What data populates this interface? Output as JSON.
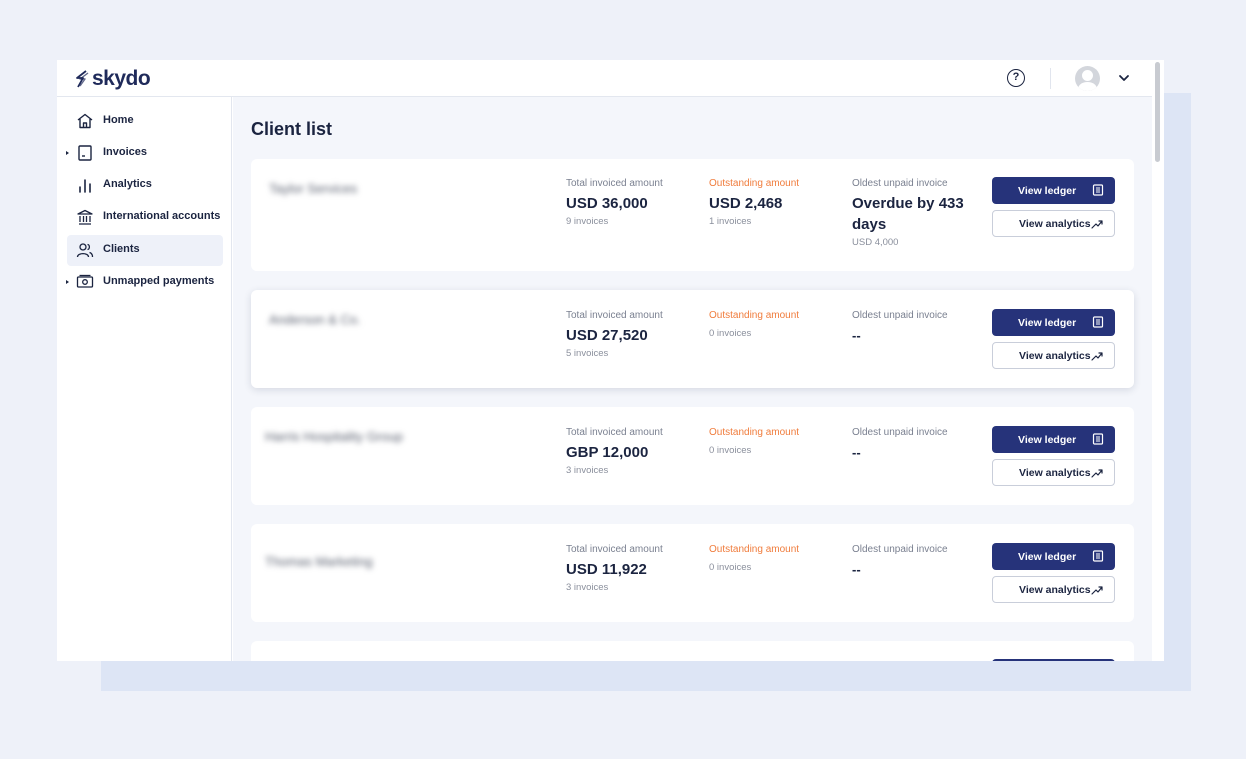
{
  "app": {
    "logo_text": "skydo"
  },
  "topbar": {
    "help_icon": "help-circle-icon",
    "avatar_icon": "user-avatar-icon",
    "menu_icon": "chevron-down-icon"
  },
  "sidebar": {
    "items": [
      {
        "label": "Home",
        "icon": "home-icon",
        "expandable": false,
        "active": false
      },
      {
        "label": "Invoices",
        "icon": "invoice-icon",
        "expandable": true,
        "active": false
      },
      {
        "label": "Analytics",
        "icon": "bar-chart-icon",
        "expandable": false,
        "active": false
      },
      {
        "label": "International accounts",
        "icon": "bank-icon",
        "expandable": false,
        "active": false
      },
      {
        "label": "Clients",
        "icon": "users-icon",
        "expandable": false,
        "active": true
      },
      {
        "label": "Unmapped payments",
        "icon": "cash-icon",
        "expandable": true,
        "active": false
      }
    ]
  },
  "main": {
    "title": "Client list",
    "labels": {
      "total": "Total invoiced amount",
      "outstanding": "Outstanding amount",
      "oldest": "Oldest unpaid invoice",
      "view_ledger": "View ledger",
      "view_analytics": "View analytics"
    },
    "clients": [
      {
        "name": "Taylor Services",
        "total": "USD 36,000",
        "total_sub": "9 invoices",
        "outstanding": "USD 2,468",
        "outstanding_sub": "1 invoices",
        "oldest": "Overdue by 433 days",
        "oldest_sub": "USD 4,000"
      },
      {
        "name": "Anderson & Co.",
        "total": "USD 27,520",
        "total_sub": "5 invoices",
        "outstanding": "",
        "outstanding_sub": "0 invoices",
        "oldest": "--",
        "oldest_sub": ""
      },
      {
        "name": "Harris Hospitality Group",
        "total": "GBP 12,000",
        "total_sub": "3 invoices",
        "outstanding": "",
        "outstanding_sub": "0 invoices",
        "oldest": "--",
        "oldest_sub": ""
      },
      {
        "name": "Thomas Marketing",
        "total": "USD 11,922",
        "total_sub": "3 invoices",
        "outstanding": "",
        "outstanding_sub": "0 invoices",
        "oldest": "--",
        "oldest_sub": ""
      }
    ]
  },
  "colors": {
    "primary": "#26337a",
    "accent_orange": "#f07c3c",
    "background": "#eef1f9"
  }
}
